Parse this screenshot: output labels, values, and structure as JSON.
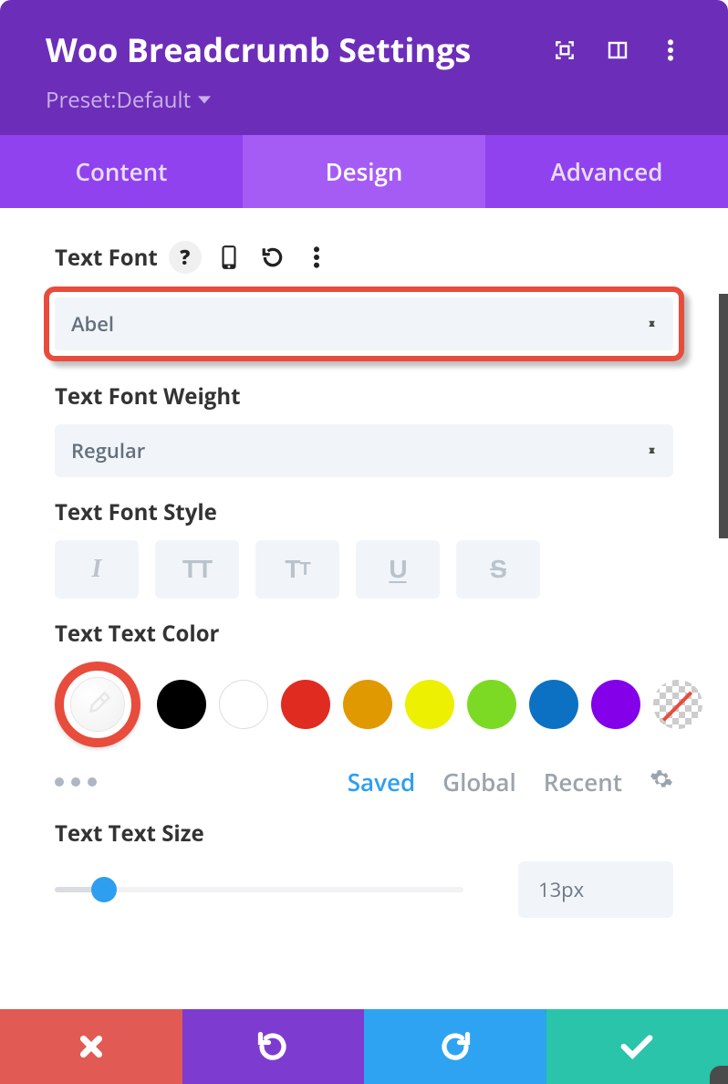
{
  "header": {
    "title": "Woo Breadcrumb Settings",
    "preset_prefix": "Preset: ",
    "preset_name": "Default"
  },
  "tabs": {
    "content": "Content",
    "design": "Design",
    "advanced": "Advanced",
    "active": "design"
  },
  "fields": {
    "text_font": {
      "label": "Text Font",
      "value": "Abel"
    },
    "text_font_weight": {
      "label": "Text Font Weight",
      "value": "Regular"
    },
    "text_font_style": {
      "label": "Text Font Style"
    },
    "text_color": {
      "label": "Text Text Color",
      "swatches": [
        {
          "name": "black",
          "hex": "#000000"
        },
        {
          "name": "white",
          "hex": "#ffffff"
        },
        {
          "name": "red",
          "hex": "#e02b20"
        },
        {
          "name": "orange",
          "hex": "#e09900"
        },
        {
          "name": "yellow",
          "hex": "#edf000"
        },
        {
          "name": "green",
          "hex": "#7cda24"
        },
        {
          "name": "blue",
          "hex": "#0c71c3"
        },
        {
          "name": "purple",
          "hex": "#8300e9"
        },
        {
          "name": "transparent",
          "hex": "transparent"
        }
      ],
      "tabs": {
        "saved": "Saved",
        "global": "Global",
        "recent": "Recent"
      }
    },
    "text_size": {
      "label": "Text Text Size",
      "value": "13px",
      "percent": 12
    }
  }
}
